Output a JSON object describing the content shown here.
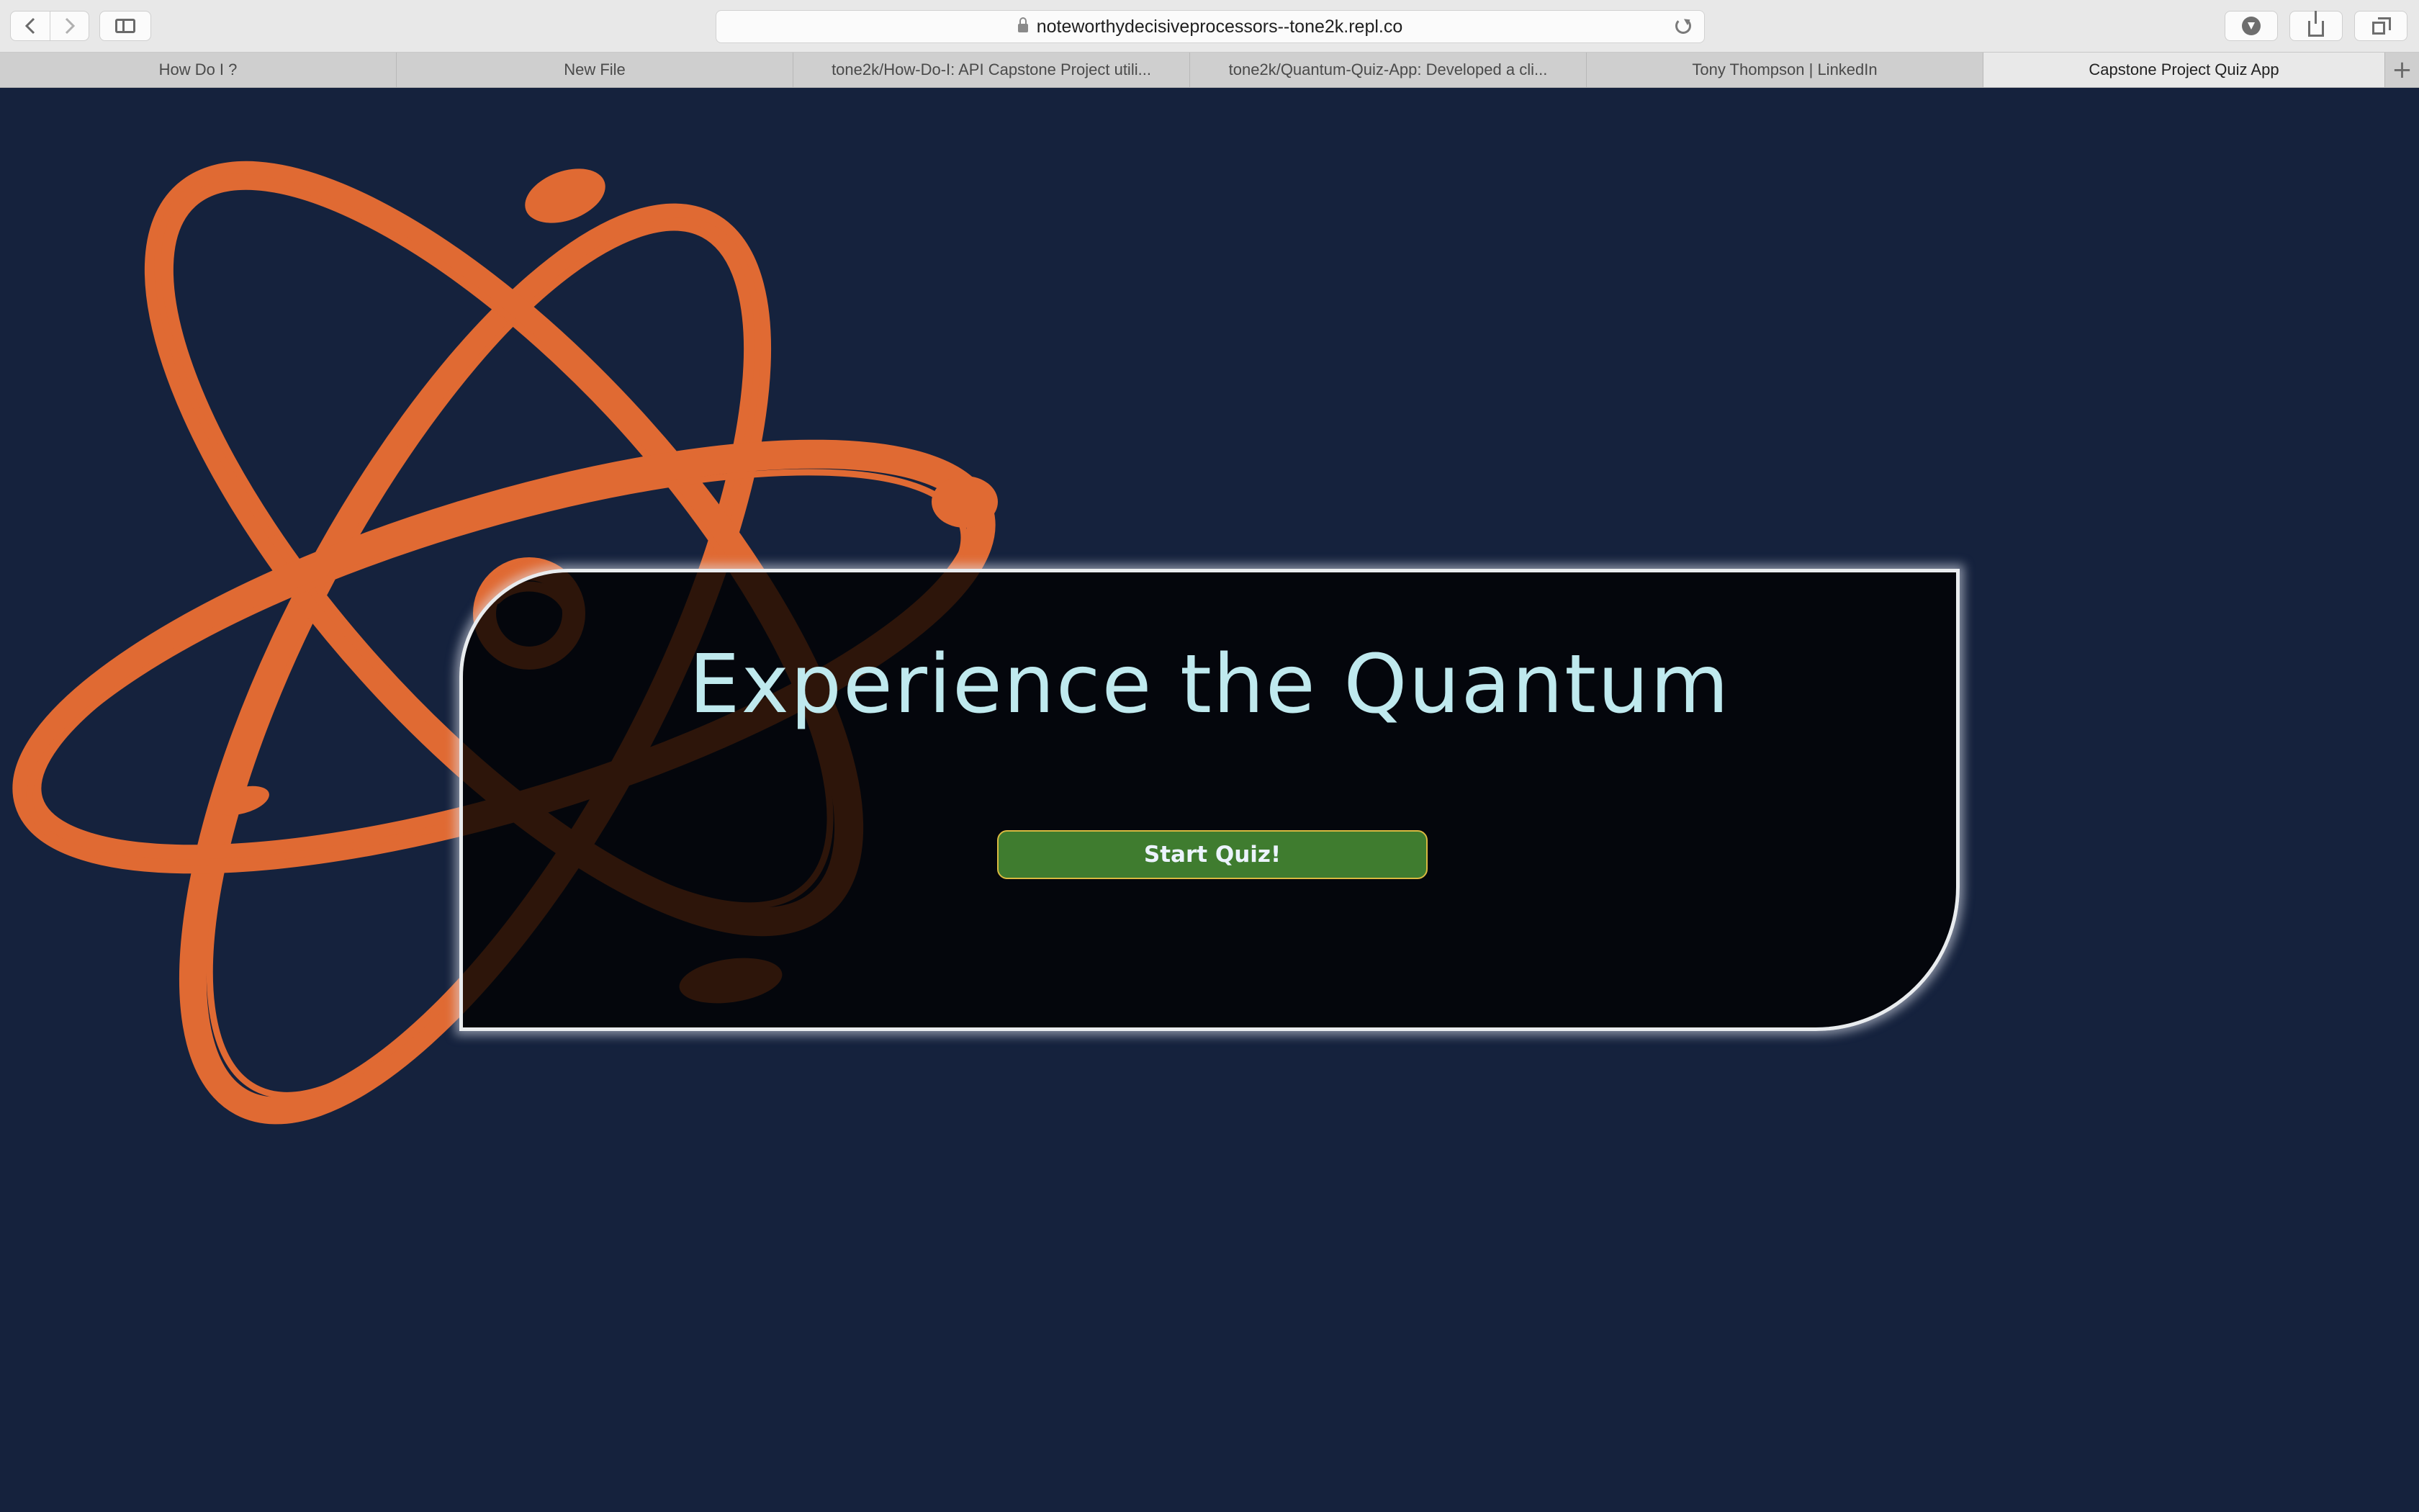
{
  "browser": {
    "url": "noteworthydecisiveprocessors--tone2k.repl.co",
    "tabs": [
      {
        "label": "How Do I ?",
        "active": false
      },
      {
        "label": "New File",
        "active": false
      },
      {
        "label": "tone2k/How-Do-I: API Capstone Project utili...",
        "active": false
      },
      {
        "label": "tone2k/Quantum-Quiz-App: Developed a cli...",
        "active": false
      },
      {
        "label": "Tony Thompson | LinkedIn",
        "active": false
      },
      {
        "label": "Capstone Project Quiz App",
        "active": true
      }
    ],
    "new_tab_symbol": "+",
    "icons": [
      "back-icon",
      "forward-icon",
      "sidebar-icon",
      "lock-icon",
      "reload-icon",
      "download-icon",
      "share-icon",
      "tabs-overview-icon"
    ]
  },
  "main": {
    "title": "Experience the Quantum",
    "start_button_label": "Start Quiz!",
    "logo_icon": "atom-icon"
  },
  "colors": {
    "page_background": "#15223d",
    "atom_logo": "#e06a33",
    "title_text": "#bfe9ee",
    "button_background": "#3f7c2f",
    "button_border": "#d9b940"
  }
}
